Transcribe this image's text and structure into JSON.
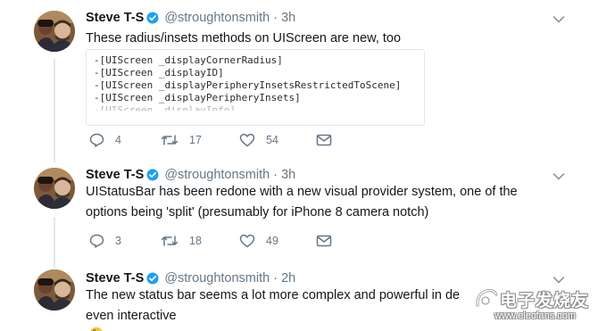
{
  "colors": {
    "link_blue": "#1da1f2",
    "muted_gray": "#657786",
    "text": "#14171a",
    "divider": "#e1e8ed"
  },
  "tweets": [
    {
      "name": "Steve T-S",
      "handle": "@stroughtonsmith",
      "separator": "·",
      "time": "3h",
      "text_lines": [
        "These radius/insets methods on UIScreen are new, too"
      ],
      "code_lines": [
        "-[UIScreen _displayCornerRadius]",
        "-[UIScreen _displayID]",
        "-[UIScreen _displayPeripheryInsetsRestrictedToScene]",
        "-[UIScreen _displayPeripheryInsets]",
        "-[UIScreen _displayInfo]"
      ],
      "reply_count": "4",
      "retweet_count": "17",
      "like_count": "54",
      "icons": [
        "reply-icon",
        "retweet-icon",
        "like-icon",
        "message-icon",
        "chevron-down-icon",
        "verified-badge-icon"
      ]
    },
    {
      "name": "Steve T-S",
      "handle": "@stroughtonsmith",
      "separator": "·",
      "time": "3h",
      "text_lines": [
        "UIStatusBar has been redone with a new visual provider system, one of the",
        "options being 'split' (presumably for iPhone 8 camera notch)"
      ],
      "reply_count": "3",
      "retweet_count": "18",
      "like_count": "49"
    },
    {
      "name": "Steve T-S",
      "handle": "@stroughtonsmith",
      "separator": "·",
      "time": "2h",
      "text_lines": [
        "The new status bar seems a lot more complex and powerful in de",
        "even interactive"
      ],
      "emoji": "thinking-face-emoji"
    }
  ],
  "watermark": {
    "title": "电子发烧友",
    "url": "www.elecfans.com"
  }
}
